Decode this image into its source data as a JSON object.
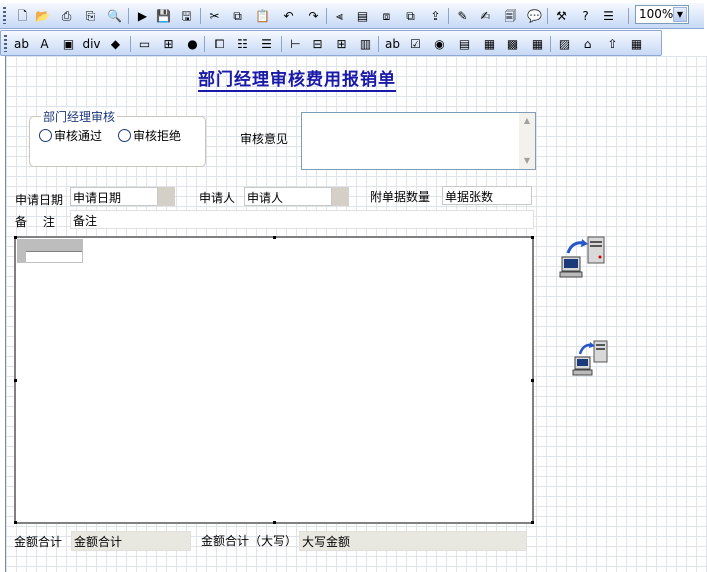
{
  "toolbar1": {
    "icons": [
      "new-icon",
      "open-icon",
      "print-icon",
      "print-preview-icon",
      "find-icon",
      "run-icon",
      "save-icon",
      "save-all-icon",
      "cut-icon",
      "copy-icon",
      "paste-icon",
      "undo-icon",
      "redo-icon",
      "align-left-icon",
      "properties-icon",
      "bring-front-icon",
      "send-back-icon",
      "export-icon",
      "edit-icon",
      "script-icon",
      "page-setup-icon",
      "message-icon",
      "tools-icon",
      "help-icon",
      "list-icon"
    ],
    "zoom_value": "100%"
  },
  "toolbar2": {
    "icons": [
      "textbox-icon",
      "label-icon",
      "image-icon",
      "div-icon",
      "shape-icon",
      "panel-icon",
      "frame-icon",
      "chart-icon",
      "spinner-icon",
      "columns-icon",
      "rows-icon",
      "tree-icon",
      "table-icon",
      "grid-icon",
      "split-icon",
      "input-icon",
      "checkbox-icon",
      "radio-icon",
      "listbox-icon",
      "combobox-icon",
      "datagrid-icon",
      "toolbar-icon",
      "picture-icon",
      "home-icon",
      "upload-icon",
      "network-icon"
    ]
  },
  "form": {
    "title": "部门经理审核费用报销单",
    "review_group": {
      "legend": "部门经理审核",
      "options": [
        "审核通过",
        "审核拒绝"
      ]
    },
    "review_comment_label": "审核意见",
    "apply_date_label": "申请日期",
    "apply_date_value": "申请日期",
    "applicant_label": "申请人",
    "applicant_value": "申请人",
    "attachments_label": "附单据数量",
    "attachments_value": "单据张数",
    "remark_label": "备　 注",
    "remark_value": "备注",
    "total_label": "金额合计",
    "total_value": "金额合计",
    "total_upper_label": "金额合计（大写）",
    "total_upper_value": "大写金额"
  },
  "colors": {
    "title": "#1a1aa8",
    "legend": "#1d3a7a",
    "toolbar_top": "#f6f9fe",
    "toolbar_bottom": "#c7d9f6"
  }
}
